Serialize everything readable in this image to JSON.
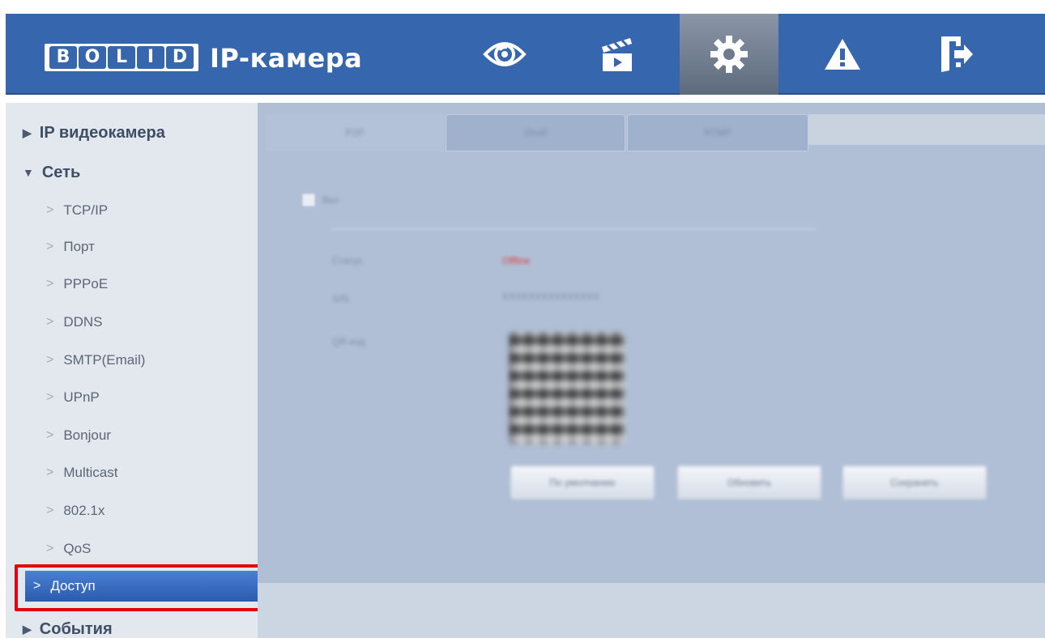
{
  "header": {
    "logo_letters": [
      "B",
      "O",
      "L",
      "I",
      "D"
    ],
    "app_title": "IP-камера",
    "nav": [
      {
        "name": "live-view",
        "icon": "eye-icon"
      },
      {
        "name": "playback",
        "icon": "clapperboard-icon"
      },
      {
        "name": "settings",
        "icon": "gear-icon",
        "active": true
      },
      {
        "name": "alarm",
        "icon": "warning-icon"
      },
      {
        "name": "logout",
        "icon": "exit-door-icon"
      }
    ]
  },
  "sidebar": {
    "sections": [
      {
        "label": "IP видеокамера",
        "expanded": false
      },
      {
        "label": "Сеть",
        "expanded": true
      },
      {
        "label": "События",
        "expanded": false
      }
    ],
    "network_items": [
      {
        "label": "TCP/IP"
      },
      {
        "label": "Порт"
      },
      {
        "label": "PPPoE"
      },
      {
        "label": "DDNS"
      },
      {
        "label": "SMTP(Email)"
      },
      {
        "label": "UPnP"
      },
      {
        "label": "Bonjour"
      },
      {
        "label": "Multicast"
      },
      {
        "label": "802.1x"
      },
      {
        "label": "QoS"
      },
      {
        "label": "Доступ",
        "selected": true
      }
    ],
    "highlight_color": "#e3000f"
  },
  "content": {
    "tabs": [
      "P2P",
      "Onvif",
      "RTMP"
    ],
    "enable_label": "Вкл",
    "rows": [
      {
        "label": "Статус",
        "value": "Offline"
      },
      {
        "label": "S/N",
        "value": "XXXXXXXXXXXXXXX"
      },
      {
        "label": "QR-код",
        "value": ""
      }
    ],
    "buttons": [
      "По умолчанию",
      "Обновить",
      "Сохранить"
    ]
  },
  "colors": {
    "header_bg": "#3566ae",
    "sidebar_bg": "#e3e7ee",
    "selected_item": "#3a6fc4",
    "content_bg": "#b0bfd6",
    "status_offline": "#e23a3a"
  }
}
